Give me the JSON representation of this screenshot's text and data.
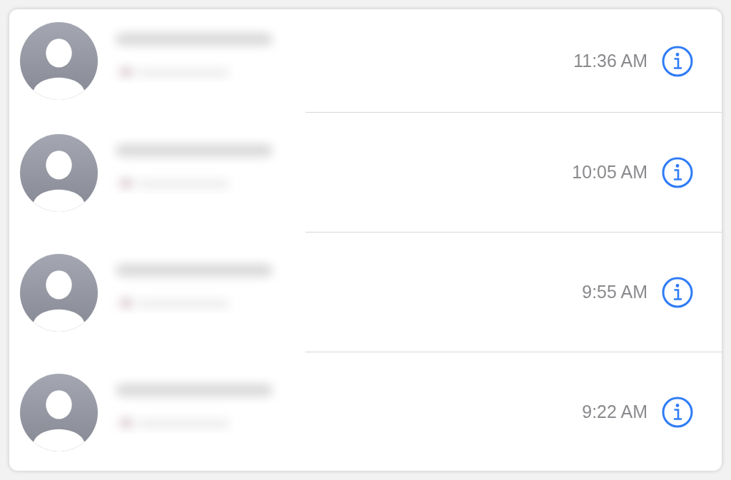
{
  "calls": [
    {
      "time": "11:36 AM"
    },
    {
      "time": "10:05 AM"
    },
    {
      "time": "9:55 AM"
    },
    {
      "time": "9:22 AM"
    }
  ]
}
